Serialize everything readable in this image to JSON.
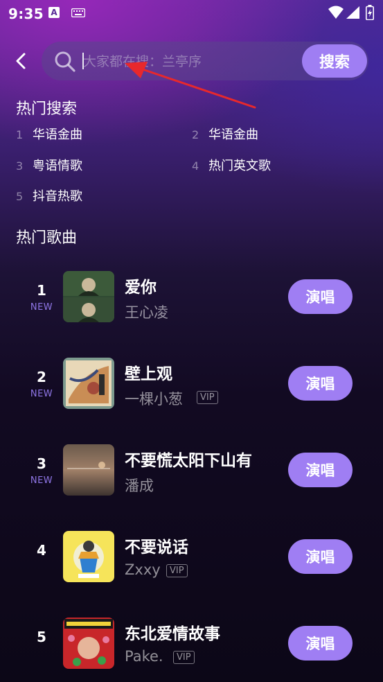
{
  "status_bar": {
    "time": "9:35",
    "icons": [
      "a-icon",
      "keyboard-icon",
      "wifi-icon",
      "signal-icon",
      "battery-icon"
    ]
  },
  "search": {
    "placeholder": "大家都在搜：兰亭序",
    "value": "",
    "button_label": "搜索"
  },
  "hot_search": {
    "title": "热门搜索",
    "items": [
      {
        "rank": "1",
        "label": "华语金曲"
      },
      {
        "rank": "2",
        "label": "华语金曲"
      },
      {
        "rank": "3",
        "label": "粤语情歌"
      },
      {
        "rank": "4",
        "label": "热门英文歌"
      },
      {
        "rank": "5",
        "label": "抖音热歌"
      }
    ]
  },
  "hot_songs": {
    "title": "热门歌曲",
    "sing_label": "演唱",
    "vip_label": "VIP",
    "new_label": "NEW",
    "songs": [
      {
        "rank": "1",
        "new": true,
        "title": "爱你",
        "artist": "王心凌",
        "vip": false
      },
      {
        "rank": "2",
        "new": true,
        "title": "壁上观",
        "artist": "一棵小葱",
        "vip": true
      },
      {
        "rank": "3",
        "new": true,
        "title": "不要慌太阳下山有",
        "artist": "潘成",
        "vip": false
      },
      {
        "rank": "4",
        "new": false,
        "title": "不要说话",
        "artist": "Zxxy",
        "vip": true
      },
      {
        "rank": "5",
        "new": false,
        "title": "东北爱情故事",
        "artist": "Pake.",
        "vip": true
      }
    ]
  },
  "colors": {
    "accent": "#9f7ef3",
    "new_badge": "#8f76e6",
    "annotation_arrow": "#e8282c"
  }
}
